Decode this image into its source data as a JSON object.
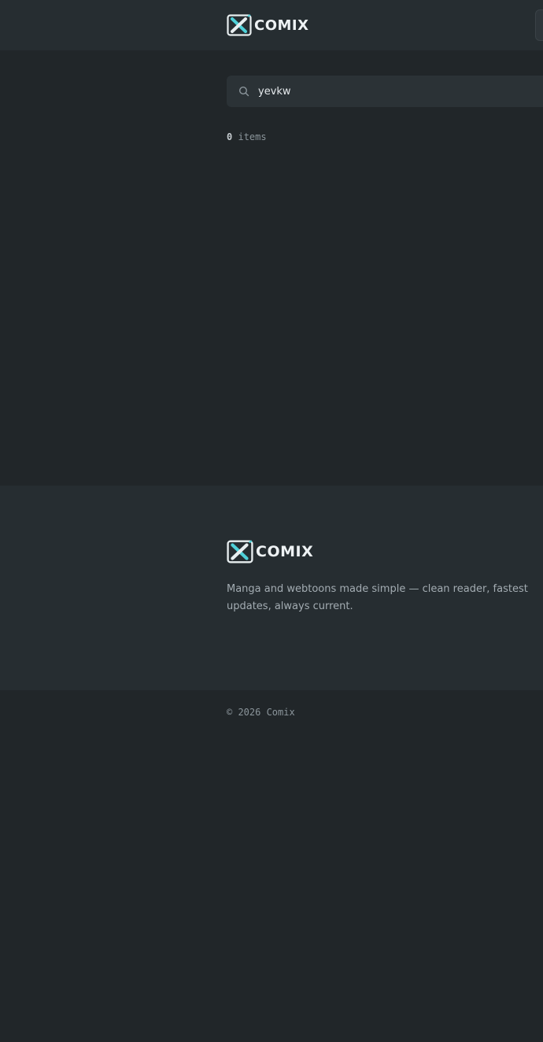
{
  "header": {
    "logo_text": "COMIX",
    "logo_icon": "comix-x-logo-icon"
  },
  "search": {
    "value": "yevkw",
    "icon": "search-icon"
  },
  "results": {
    "count": "0",
    "label": "items"
  },
  "footer": {
    "logo_text": "COMIX",
    "tagline": "Manga and webtoons made simple — clean reader, fastest updates, always current.",
    "copyright": "© 2026 Comix"
  },
  "colors": {
    "background": "#212629",
    "surface": "#262d31",
    "accent": "#4fd1d9"
  }
}
